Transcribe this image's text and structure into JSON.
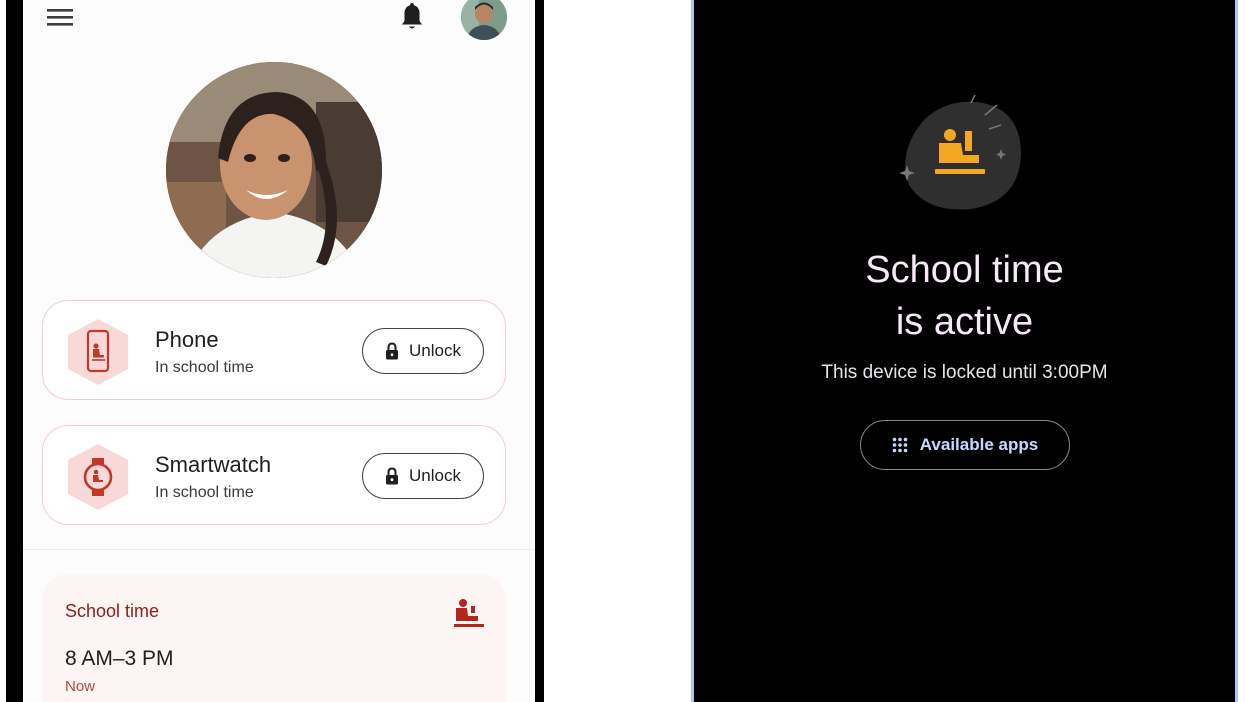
{
  "parent_app": {
    "header": {
      "menu_icon": "hamburger-menu-icon",
      "notifications_icon": "bell-icon"
    },
    "devices": [
      {
        "name": "Phone",
        "status": "In school time",
        "icon": "phone-school-icon",
        "action_label": "Unlock"
      },
      {
        "name": "Smartwatch",
        "status": "In school time",
        "icon": "watch-school-icon",
        "action_label": "Unlock"
      }
    ],
    "school_time": {
      "title": "School time",
      "hours": "8 AM–3 PM",
      "state": "Now",
      "icon": "student-seat-icon"
    }
  },
  "child_device": {
    "headline_line1": "School time",
    "headline_line2": "is active",
    "locked_message": "This device is locked until 3:00PM",
    "apps_button_label": "Available apps",
    "icon": "student-raised-hand-icon"
  },
  "colors": {
    "card_border": "#f1cfcf",
    "brand_red": "#8c1d18",
    "accent_orange": "#f5a623",
    "dark_headline": "#f6e9f8",
    "apps_button_text": "#c7d7ff"
  }
}
